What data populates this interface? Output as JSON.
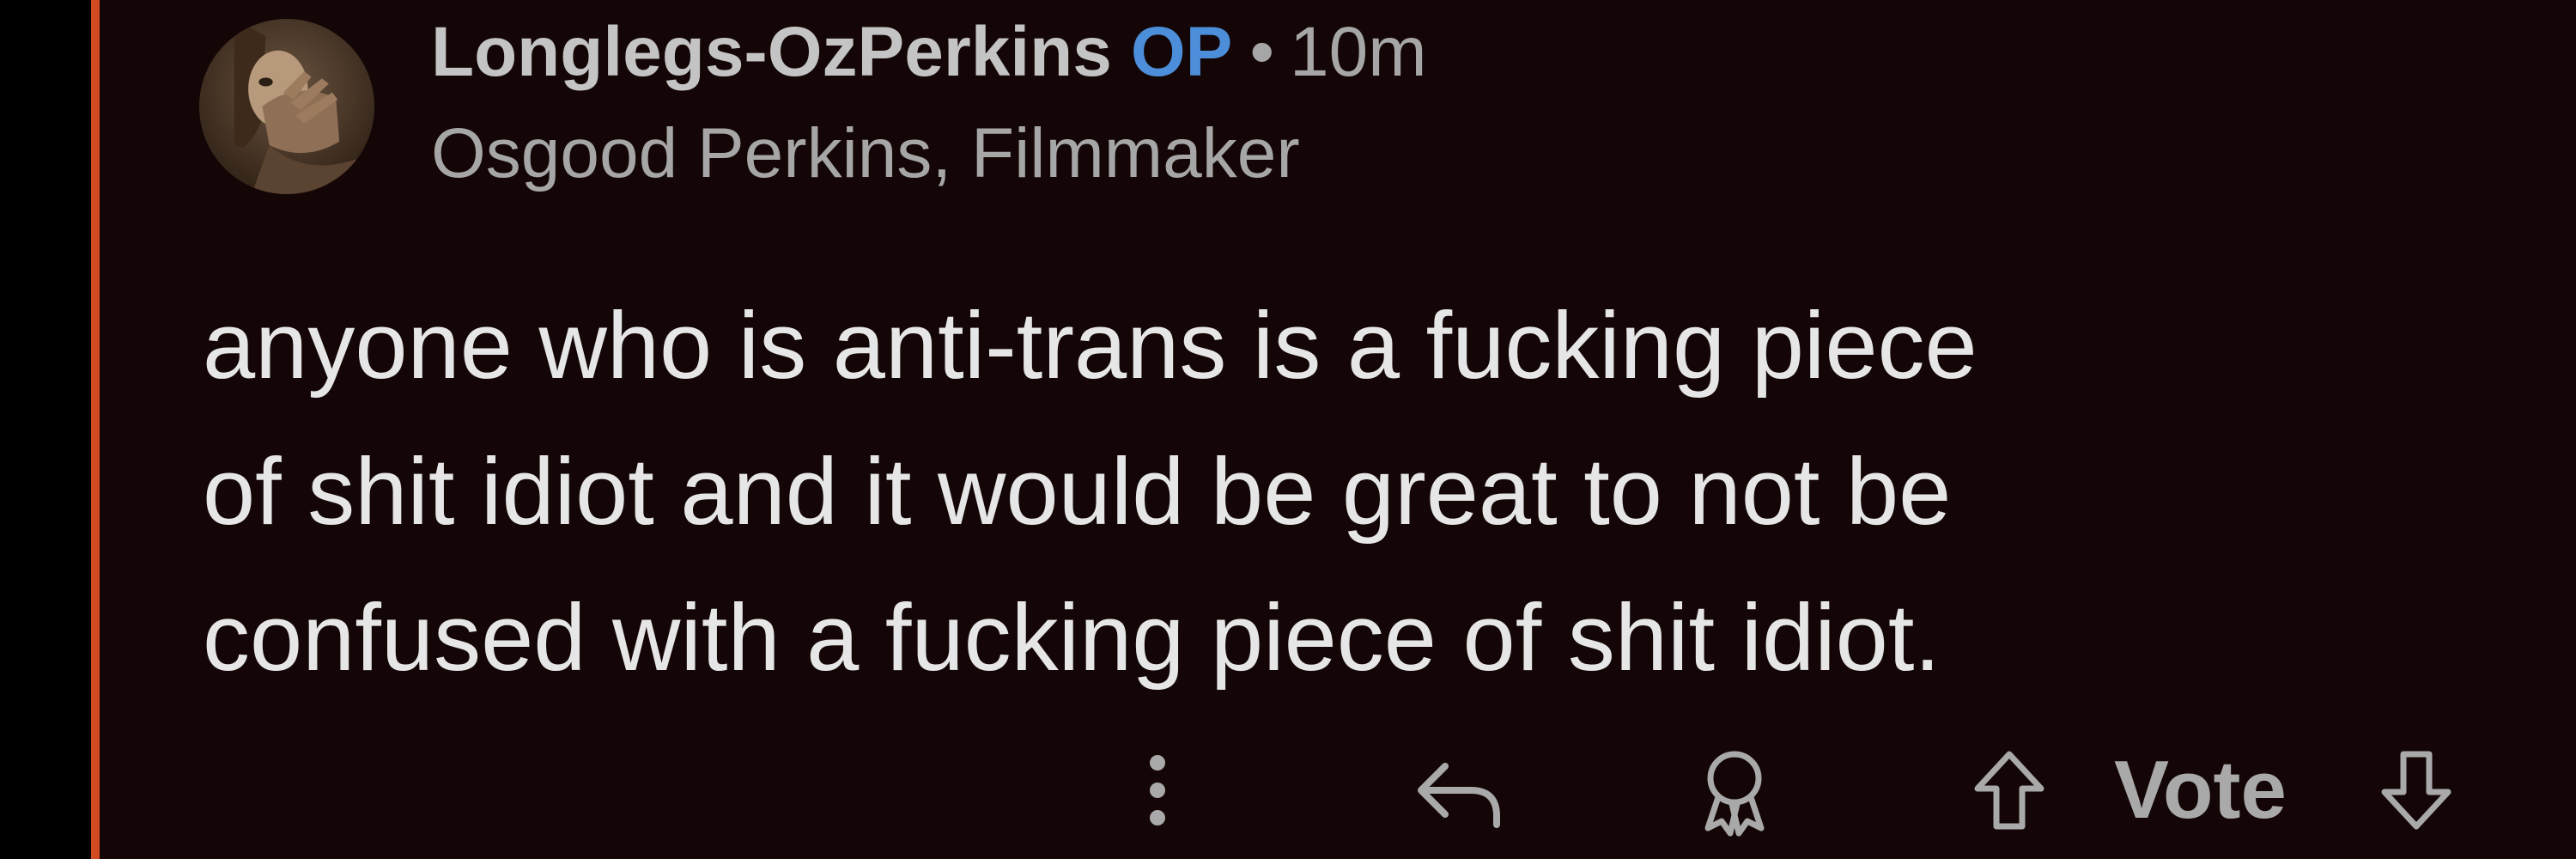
{
  "comment": {
    "author": "Longlegs-OzPerkins",
    "op_badge": "OP",
    "separator": "•",
    "timestamp": "10m",
    "flair": "Osgood Perkins, Filmmaker",
    "body_lines": [
      "anyone who is anti-trans is a fucking piece",
      "of shit idiot and it would be great to not be",
      "confused with a fucking piece of shit idiot."
    ]
  },
  "actions": {
    "more_icon": "more-vertical-icon",
    "reply_icon": "reply-icon",
    "award_icon": "award-icon",
    "upvote_icon": "arrow-up-icon",
    "vote_label": "Vote",
    "downvote_icon": "arrow-down-icon"
  },
  "colors": {
    "background": "#140606",
    "thread_line": "#d24a22",
    "username": "#c4c4c4",
    "op_badge": "#4c8ed9",
    "meta_text": "#a6a6a6",
    "body_text": "#e6e6e6"
  }
}
